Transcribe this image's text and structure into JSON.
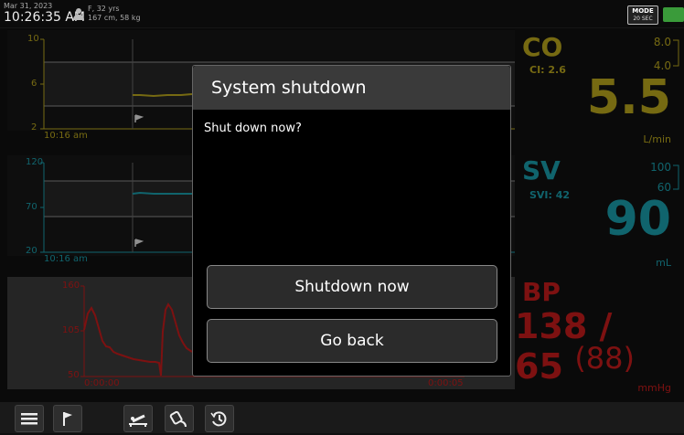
{
  "header": {
    "date": "Mar 31, 2023",
    "time": "10:26:35 AM",
    "patient_line1": "F, 32 yrs",
    "patient_line2": "167 cm, 58 kg",
    "mode_label": "MODE",
    "mode_value": "20 SEC"
  },
  "charts": {
    "co": {
      "y_ticks": [
        "10",
        "6",
        "2"
      ],
      "time_label": "10:16 am",
      "color": "#b6a31d",
      "target_range": [
        4.0,
        8.0
      ],
      "trend_value": 5.5
    },
    "sv": {
      "y_ticks": [
        "120",
        "70",
        "20"
      ],
      "time_label": "10:16 am",
      "color": "#1a9aa8",
      "target_range": [
        60,
        100
      ],
      "trend_value": 90
    },
    "bp": {
      "y_ticks": [
        "160",
        "105",
        "50"
      ],
      "time_start": "0:00:00",
      "time_end": "0:00:05",
      "color": "#c01b1b"
    }
  },
  "params": {
    "co": {
      "name": "CO",
      "sub": "CI: 2.6",
      "upper": "8.0",
      "lower": "4.0",
      "value": "5.5",
      "unit": "L/min",
      "color": "#b6a31d"
    },
    "sv": {
      "name": "SV",
      "sub": "SVI: 42",
      "upper": "100",
      "lower": "60",
      "value": "90",
      "unit": "mL",
      "color": "#1a9aa8"
    },
    "bp": {
      "name": "BP",
      "value": "138 / 65",
      "map": "(88)",
      "unit": "mmHg",
      "color": "#c01b1b"
    }
  },
  "toolbar": {
    "icons": [
      "menu-icon",
      "flag-icon",
      "patient-bed-icon",
      "sensor-icon",
      "history-icon"
    ]
  },
  "dialog": {
    "title": "System shutdown",
    "message": "Shut down now?",
    "primary_button": "Shutdown now",
    "secondary_button": "Go back"
  }
}
